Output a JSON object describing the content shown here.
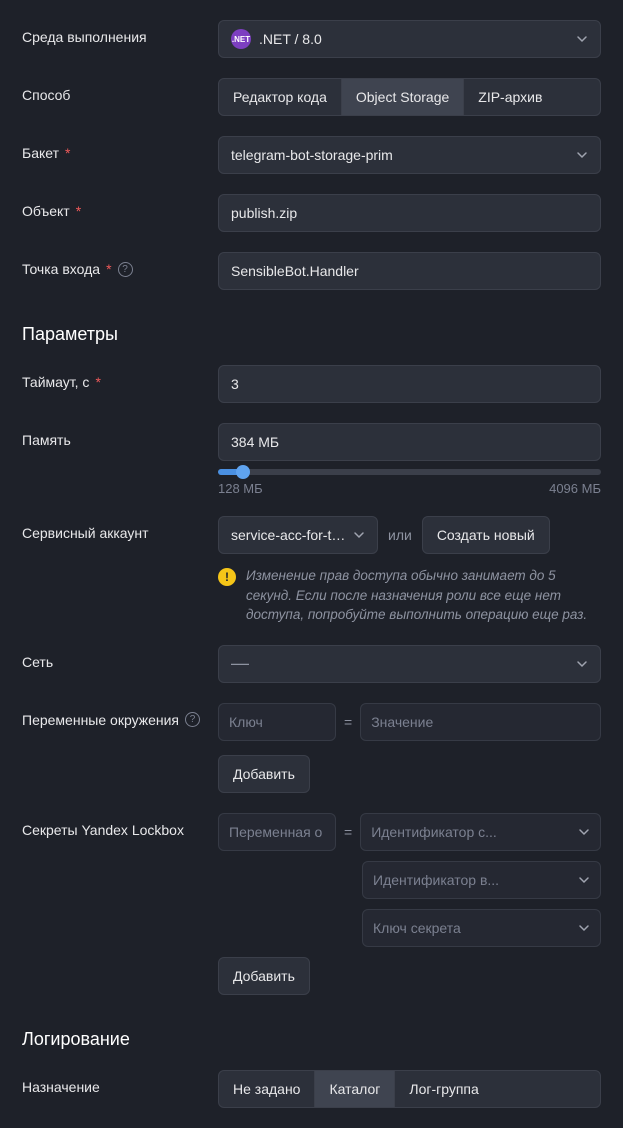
{
  "runtime": {
    "label": "Среда выполнения",
    "value": ".NET / 8.0",
    "badge": ".NET"
  },
  "method": {
    "label": "Способ",
    "options": {
      "code_editor": "Редактор кода",
      "object_storage": "Object Storage",
      "zip_archive": "ZIP-архив"
    }
  },
  "bucket": {
    "label": "Бакет",
    "value": "telegram-bot-storage-prim"
  },
  "object": {
    "label": "Объект",
    "value": "publish.zip"
  },
  "entrypoint": {
    "label": "Точка входа",
    "value": "SensibleBot.Handler"
  },
  "section_params": "Параметры",
  "timeout": {
    "label": "Таймаут, с",
    "value": "3"
  },
  "memory": {
    "label": "Память",
    "value": "384 МБ",
    "min_label": "128 МБ",
    "max_label": "4096 МБ"
  },
  "service_account": {
    "label": "Сервисный аккаунт",
    "value": "service-acc-for-tel...",
    "or": "или",
    "create_new": "Создать новый",
    "warning": "Изменение прав доступа обычно занимает до 5 секунд. Если после назначения роли все еще нет доступа, попробуйте выполнить операцию еще раз."
  },
  "network": {
    "label": "Сеть",
    "value": "—"
  },
  "env_vars": {
    "label": "Переменные окружения",
    "key_placeholder": "Ключ",
    "value_placeholder": "Значение",
    "add": "Добавить"
  },
  "lockbox": {
    "label": "Секреты Yandex Lockbox",
    "var_placeholder": "Переменная о",
    "secret_id_placeholder": "Идентификатор с...",
    "version_id_placeholder": "Идентификатор в...",
    "secret_key_placeholder": "Ключ секрета",
    "add": "Добавить"
  },
  "section_logging": "Логирование",
  "destination": {
    "label": "Назначение",
    "options": {
      "none": "Не задано",
      "catalog": "Каталог",
      "log_group": "Лог-группа"
    }
  }
}
